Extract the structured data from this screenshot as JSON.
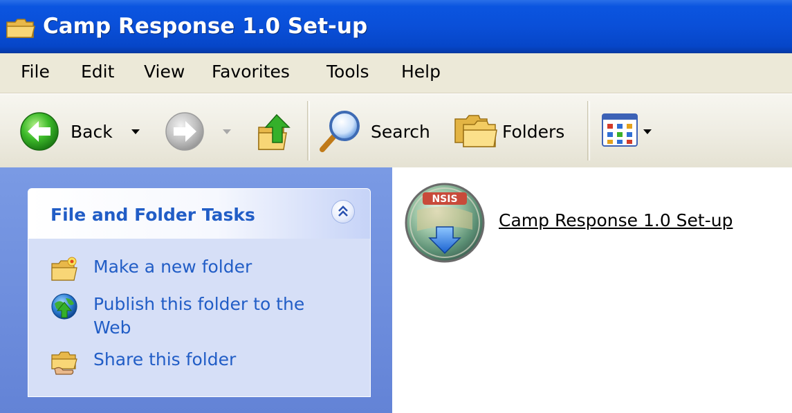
{
  "window": {
    "title": "Camp Response 1.0 Set-up"
  },
  "menu": {
    "items": [
      "File",
      "Edit",
      "View",
      "Favorites",
      "Tools",
      "Help"
    ]
  },
  "toolbar": {
    "back_label": "Back",
    "search_label": "Search",
    "folders_label": "Folders",
    "icons": [
      "back-arrow-icon",
      "forward-arrow-icon",
      "up-folder-icon",
      "search-magnifier-icon",
      "folders-icon",
      "views-icon"
    ]
  },
  "tasks": {
    "title": "File and Folder Tasks",
    "items": [
      {
        "label": "Make a new folder",
        "icon": "new-folder-icon"
      },
      {
        "label": "Publish this folder to the Web",
        "icon": "publish-web-icon"
      },
      {
        "label": "Share this folder",
        "icon": "share-folder-icon"
      }
    ]
  },
  "content": {
    "file": {
      "name": "Camp Response 1.0 Set-up",
      "icon_text": "NSIS"
    }
  },
  "colors": {
    "titlebar_blue": "#0a4fd8",
    "task_link_blue": "#215dc6",
    "pane_blue": "#6f8fde",
    "menubar_beige": "#ece9d8"
  }
}
